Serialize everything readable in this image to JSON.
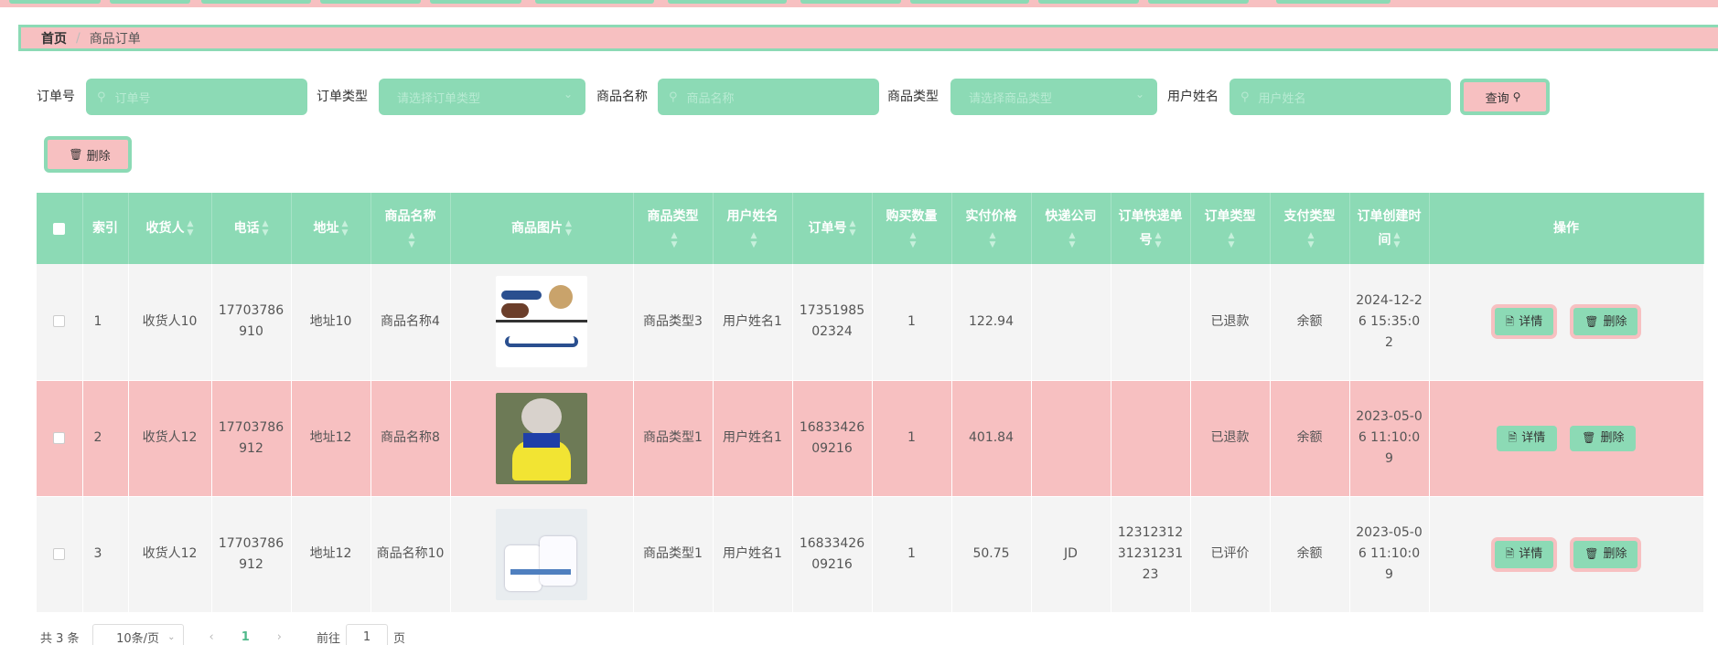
{
  "breadcrumb": {
    "home": "首页",
    "separator": "/",
    "current": "商品订单"
  },
  "search": {
    "order_no": {
      "label": "订单号",
      "placeholder": "订单号"
    },
    "order_type": {
      "label": "订单类型",
      "placeholder": "请选择订单类型"
    },
    "product_name": {
      "label": "商品名称",
      "placeholder": "商品名称"
    },
    "product_type": {
      "label": "商品类型",
      "placeholder": "请选择商品类型"
    },
    "user_name": {
      "label": "用户姓名",
      "placeholder": "用户姓名"
    },
    "query_label": "查询"
  },
  "toolbar": {
    "delete_label": "删除"
  },
  "table": {
    "headers": {
      "index": "索引",
      "receiver": "收货人",
      "phone": "电话",
      "address": "地址",
      "product_name": "商品名称",
      "product_image": "商品图片",
      "product_type": "商品类型",
      "user_name": "用户姓名",
      "order_no": "订单号",
      "quantity": "购买数量",
      "price": "实付价格",
      "courier": "快递公司",
      "tracking_no": "订单快递单号",
      "order_type": "订单类型",
      "pay_type": "支付类型",
      "created": "订单创建时间",
      "ops": "操作"
    },
    "rows": [
      {
        "index": "1",
        "receiver": "收货人10",
        "phone": "17703786910",
        "address": "地址10",
        "product_name": "商品名称4",
        "product_type": "商品类型3",
        "user_name": "用户姓名1",
        "order_no": "1735198502324",
        "quantity": "1",
        "price": "122.94",
        "courier": "",
        "tracking_no": "",
        "order_type": "已退款",
        "pay_type": "余额",
        "created": "2024-12-26 15:35:02"
      },
      {
        "index": "2",
        "receiver": "收货人12",
        "phone": "17703786912",
        "address": "地址12",
        "product_name": "商品名称8",
        "product_type": "商品类型1",
        "user_name": "用户姓名1",
        "order_no": "1683342609216",
        "quantity": "1",
        "price": "401.84",
        "courier": "",
        "tracking_no": "",
        "order_type": "已退款",
        "pay_type": "余额",
        "created": "2023-05-06 11:10:09"
      },
      {
        "index": "3",
        "receiver": "收货人12",
        "phone": "17703786912",
        "address": "地址12",
        "product_name": "商品名称10",
        "product_type": "商品类型1",
        "user_name": "用户姓名1",
        "order_no": "1683342609216",
        "quantity": "1",
        "price": "50.75",
        "courier": "JD",
        "tracking_no": "1231231231231231 23",
        "order_type": "已评价",
        "pay_type": "余额",
        "created": "2023-05-06 11:10:09"
      }
    ],
    "detail_label": "详情",
    "delete_label": "删除"
  },
  "pagination": {
    "total": "共 3 条",
    "page_size": "10条/页",
    "current": "1",
    "goto_label": "前往",
    "goto_value": "1",
    "page_unit": "页"
  },
  "colors": {
    "mint": "#8cdab5",
    "pink": "#f7c0c1",
    "row_grey": "#f4f4f4"
  }
}
